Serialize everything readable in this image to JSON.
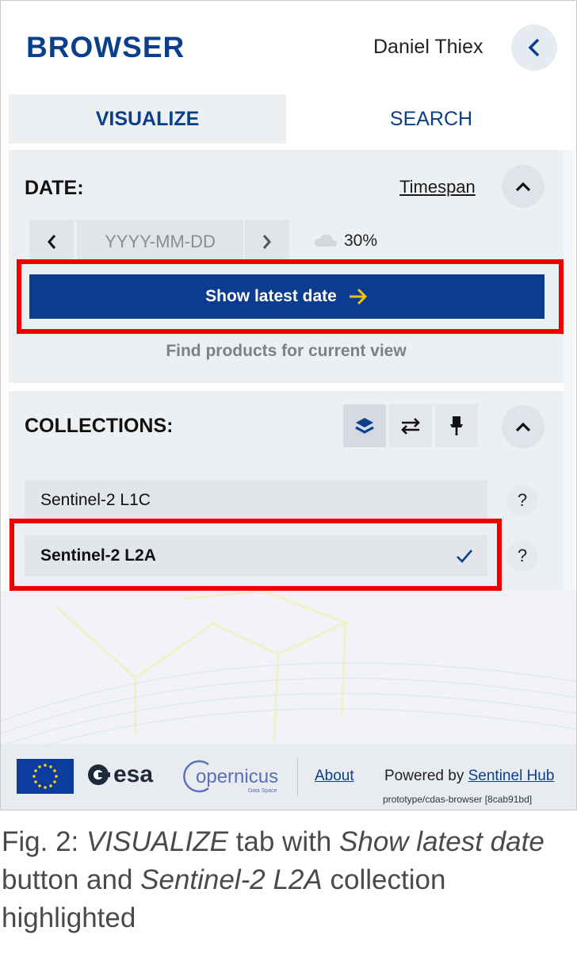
{
  "header": {
    "app_title": "BROWSER",
    "user_name": "Daniel Thiex",
    "back_icon": "chevron-left-icon"
  },
  "tabs": [
    {
      "label": "VISUALIZE",
      "active": true
    },
    {
      "label": "SEARCH",
      "active": false
    }
  ],
  "date_section": {
    "title": "DATE:",
    "timespan_link": "Timespan",
    "date_placeholder": "YYYY-MM-DD",
    "cloud_coverage": "30%",
    "show_latest_label": "Show latest date",
    "find_products_label": "Find products for current view"
  },
  "collections_section": {
    "title": "COLLECTIONS:",
    "toolbar_icons": [
      "layers-icon",
      "swap-icon",
      "pin-icon"
    ],
    "items": [
      {
        "label": "Sentinel-2 L1C",
        "selected": false,
        "help": "?"
      },
      {
        "label": "Sentinel-2 L2A",
        "selected": true,
        "help": "?"
      }
    ]
  },
  "footer": {
    "esa_label": "esa",
    "copernicus_label": "opernicus",
    "copernicus_sub": "Data Space",
    "about_label": "About",
    "powered_prefix": "Powered by ",
    "powered_link": "Sentinel Hub",
    "version": "prototype/cdas-browser [8cab91bd]"
  },
  "caption": {
    "prefix": "Fig. 2: ",
    "italic_1": "VISUALIZE",
    "text_1": " tab with ",
    "italic_2": "Show latest date",
    "text_2": " button and ",
    "italic_3": "Sentinel-2 L2A",
    "text_3": " collection highlighted"
  },
  "colors": {
    "brand_blue": "#0b3f8c",
    "button_blue": "#0a3d8f",
    "highlight_red": "#ee0000",
    "panel_gray": "#edf0f3"
  }
}
